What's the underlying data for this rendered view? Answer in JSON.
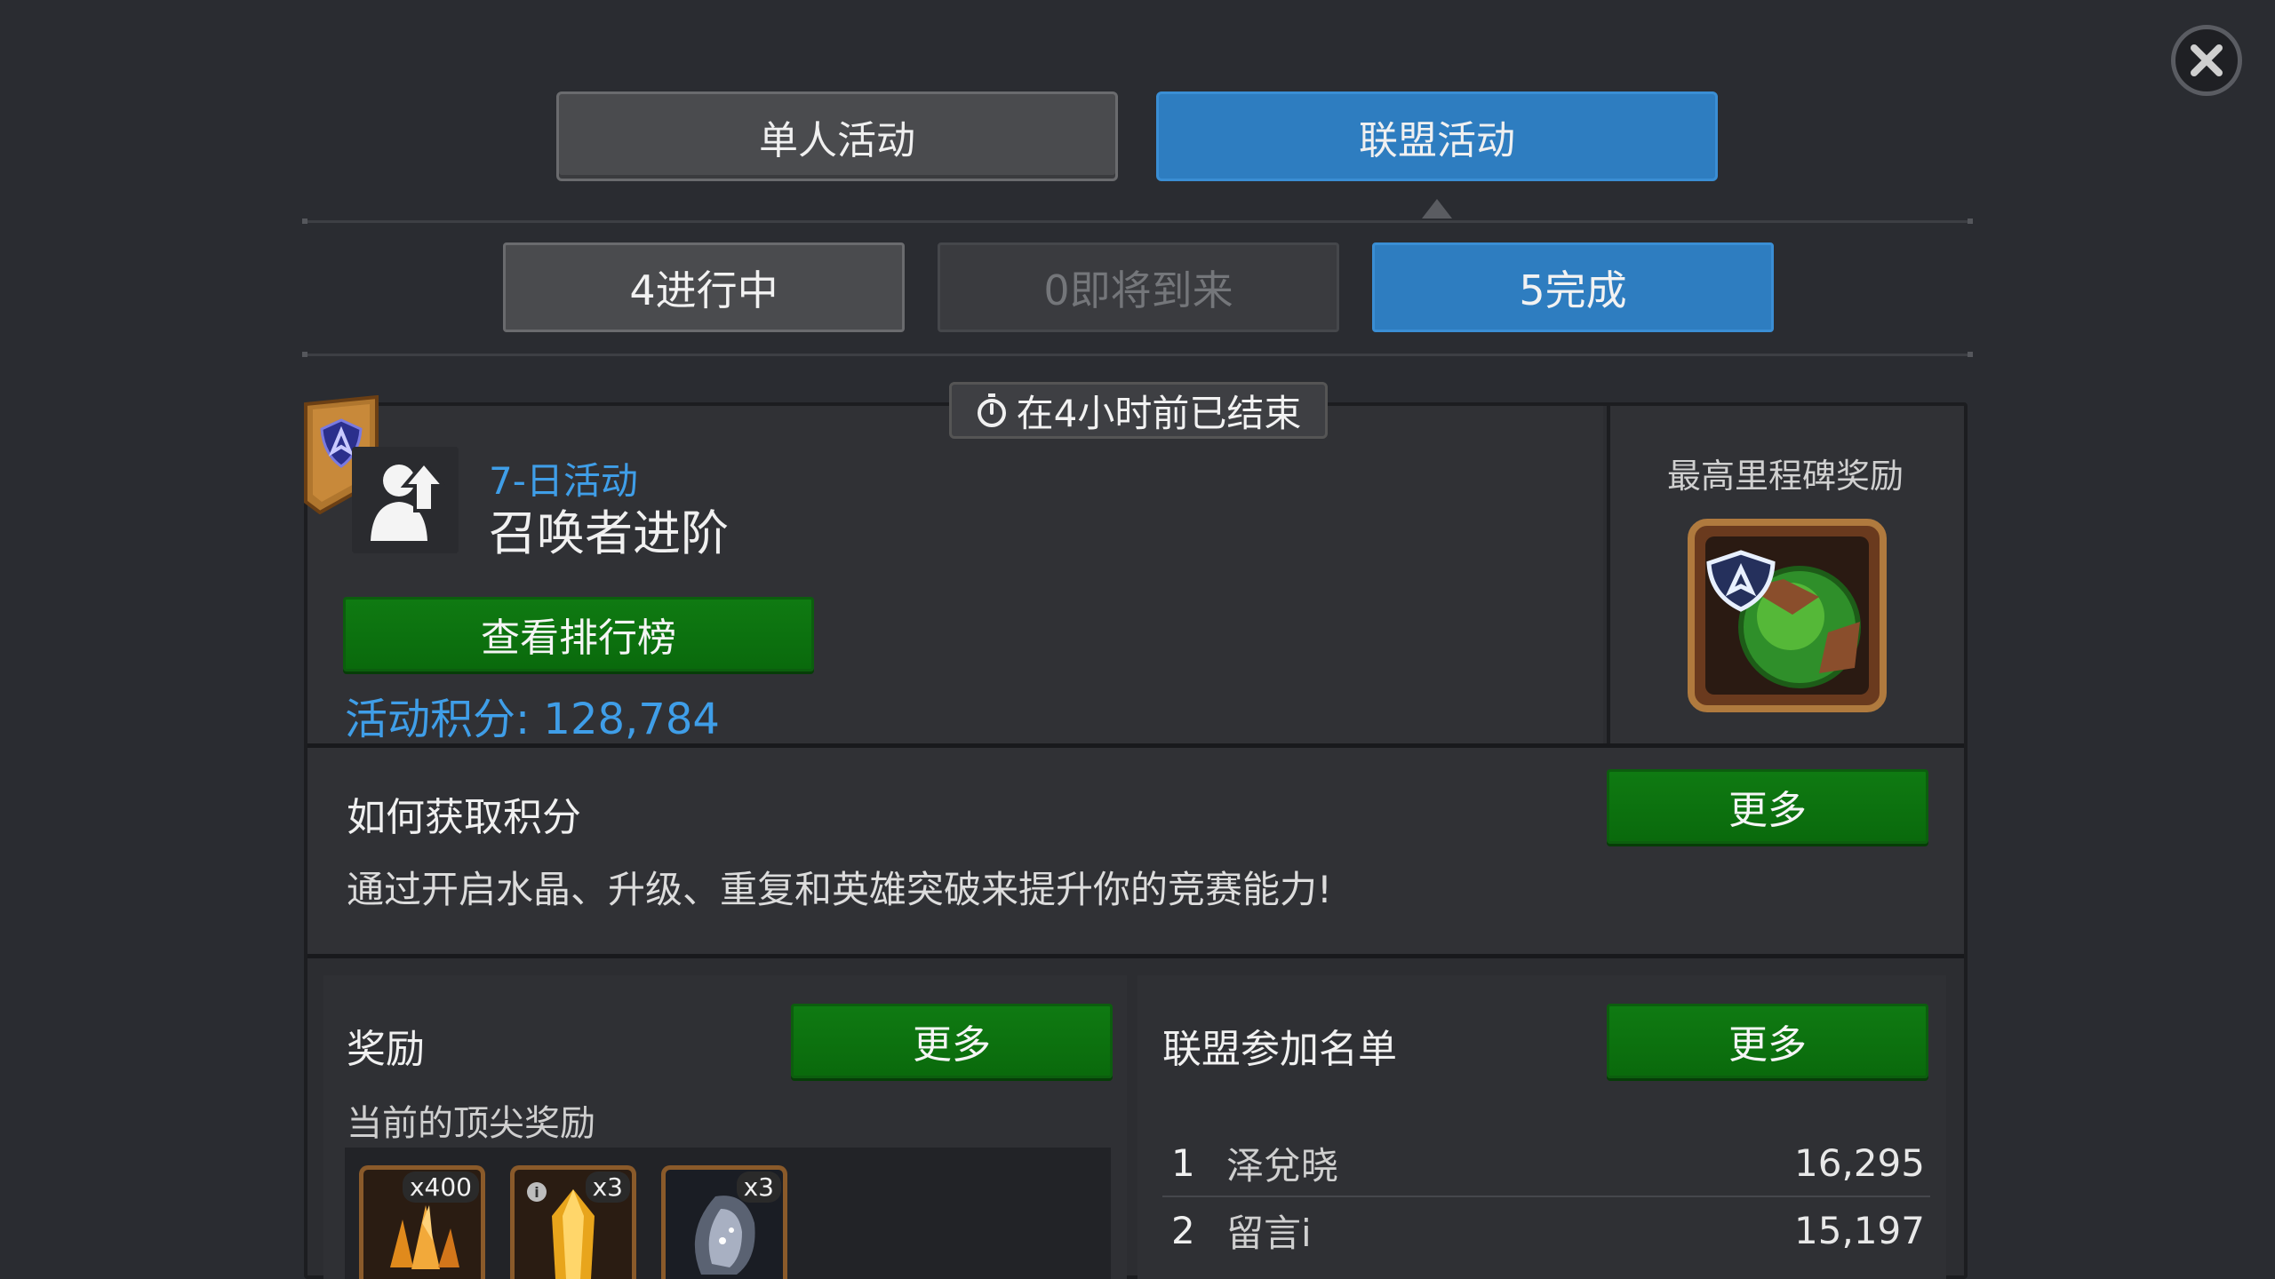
{
  "tabs": {
    "solo": "单人活动",
    "alliance": "联盟活动"
  },
  "subtabs": {
    "in_progress": "4进行中",
    "upcoming": "0即将到来",
    "completed": "5完成"
  },
  "event": {
    "ended": "在4小时前已结束",
    "type": "7-日活动",
    "name": "召唤者进阶",
    "leaderboard_button": "查看排行榜",
    "score": "活动积分: 128,784"
  },
  "milestone": {
    "title": "最高里程碑奖励"
  },
  "howto": {
    "title": "如何获取积分",
    "more": "更多",
    "description": "通过开启水晶、升级、重复和英雄突破来提升你的竞赛能力!"
  },
  "rewards": {
    "title": "奖励",
    "more": "更多",
    "current_top": "当前的顶尖奖励",
    "items": [
      {
        "icon": "shard-cluster-icon",
        "qty": "x400"
      },
      {
        "icon": "crystal-icon",
        "qty": "x3"
      },
      {
        "icon": "dark-crystal-icon",
        "qty": "x3"
      }
    ]
  },
  "alliance_list": {
    "title": "联盟参加名单",
    "more": "更多",
    "rows": [
      {
        "rank": "1",
        "name": "泽兌晓",
        "points": "16,295"
      },
      {
        "rank": "2",
        "name": "留言i",
        "points": "15,197"
      }
    ]
  }
}
